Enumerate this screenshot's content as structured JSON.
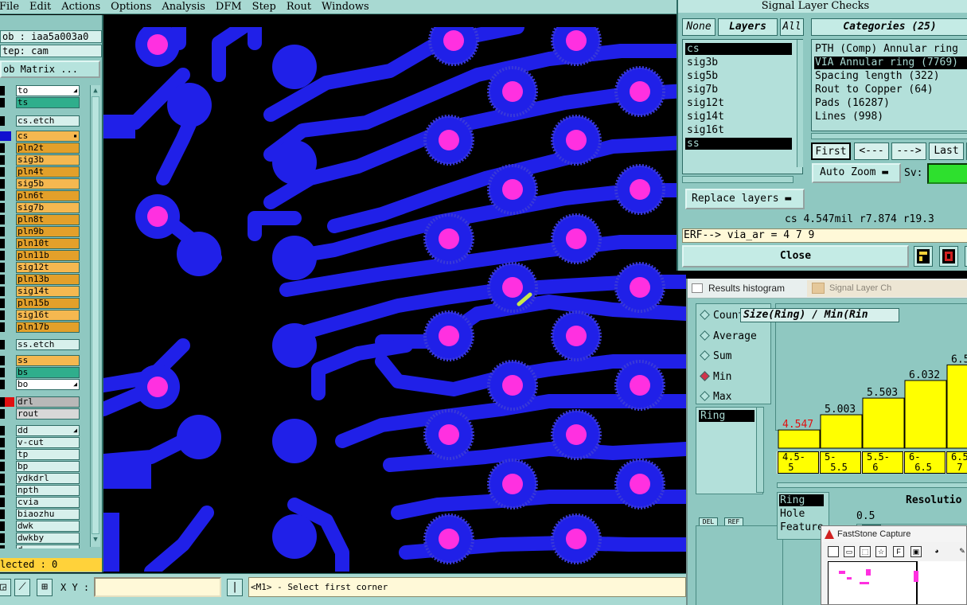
{
  "menubar": {
    "items": [
      "File",
      "Edit",
      "Actions",
      "Options",
      "Analysis",
      "DFM",
      "Step",
      "Rout",
      "Windows"
    ]
  },
  "left_panel": {
    "job": "ob : iaa5a003a0",
    "step": "tep: cam",
    "matrix_button": "ob Matrix ...",
    "layers": [
      {
        "name": "to",
        "color": "#ffffff",
        "flag": "◢"
      },
      {
        "name": "ts",
        "color": "#2fae8c"
      },
      {
        "name": "cs.etch",
        "color": "#d7f0ec"
      },
      {
        "name": "cs",
        "color": "#f5b850",
        "flag": "▪"
      },
      {
        "name": "pln2t",
        "color": "#e3a02a"
      },
      {
        "name": "sig3b",
        "color": "#f5b850"
      },
      {
        "name": "pln4t",
        "color": "#e3a02a"
      },
      {
        "name": "sig5b",
        "color": "#f5b850"
      },
      {
        "name": "pln6t",
        "color": "#e3a02a"
      },
      {
        "name": "sig7b",
        "color": "#f5b850"
      },
      {
        "name": "pln8t",
        "color": "#e3a02a"
      },
      {
        "name": "pln9b",
        "color": "#e3a02a"
      },
      {
        "name": "pln10t",
        "color": "#e3a02a"
      },
      {
        "name": "pln11b",
        "color": "#e3a02a"
      },
      {
        "name": "sig12t",
        "color": "#f5b850"
      },
      {
        "name": "pln13b",
        "color": "#e3a02a"
      },
      {
        "name": "sig14t",
        "color": "#f5b850"
      },
      {
        "name": "pln15b",
        "color": "#e3a02a"
      },
      {
        "name": "sig16t",
        "color": "#f5b850"
      },
      {
        "name": "pln17b",
        "color": "#e3a02a"
      },
      {
        "name": "ss.etch",
        "color": "#d7f0ec"
      },
      {
        "name": "ss",
        "color": "#f5b850"
      },
      {
        "name": "bs",
        "color": "#2fae8c"
      },
      {
        "name": "bo",
        "color": "#ffffff",
        "flag": "◢"
      },
      {
        "name": "drl",
        "color": "#b8b8b8"
      },
      {
        "name": "rout",
        "color": "#d8d8d8"
      },
      {
        "name": "dd",
        "color": "#d7f0ec",
        "flag": "◢"
      },
      {
        "name": "v-cut",
        "color": "#d7f0ec"
      },
      {
        "name": "tp",
        "color": "#d7f0ec"
      },
      {
        "name": "bp",
        "color": "#d7f0ec"
      },
      {
        "name": "ydkdrl",
        "color": "#d7f0ec"
      },
      {
        "name": "npth",
        "color": "#d7f0ec"
      },
      {
        "name": "cvia",
        "color": "#d7f0ec"
      },
      {
        "name": "biaozhu",
        "color": "#d7f0ec"
      },
      {
        "name": "dwk",
        "color": "#d7f0ec"
      },
      {
        "name": "dwkby",
        "color": "#d7f0ec"
      },
      {
        "name": "d",
        "color": "#d7f0ec"
      }
    ],
    "selected": "lected : 0"
  },
  "bottom_bar": {
    "xy_label": "X Y :",
    "xy_value": "",
    "prompt": "<M1> - Select first corner",
    "pipe_icon": "|"
  },
  "signal_layer_checks": {
    "title": "Signal Layer Checks",
    "tabs": {
      "none": "None",
      "layers": "Layers",
      "all": "All"
    },
    "layers": [
      {
        "name": "cs",
        "selected": true
      },
      {
        "name": "sig3b",
        "selected": false
      },
      {
        "name": "sig5b",
        "selected": false
      },
      {
        "name": "sig7b",
        "selected": false
      },
      {
        "name": "sig12t",
        "selected": false
      },
      {
        "name": "sig14t",
        "selected": false
      },
      {
        "name": "sig16t",
        "selected": false
      },
      {
        "name": "ss",
        "selected": true
      }
    ],
    "replace_button": "Replace layers",
    "categories_header": "Categories (25)",
    "categories": [
      {
        "label": "PTH (Comp) Annular ring",
        "selected": false
      },
      {
        "label": "VIA Annular ring (7769)",
        "selected": true
      },
      {
        "label": "Spacing length (322)",
        "selected": false
      },
      {
        "label": "Rout to Copper (64)",
        "selected": false
      },
      {
        "label": "Pads (16287)",
        "selected": false
      },
      {
        "label": "Lines (998)",
        "selected": false
      }
    ],
    "nav": {
      "first": "First",
      "prev": "<---",
      "next": "--->",
      "last": "Last",
      "extra": "L"
    },
    "auto_zoom": "Auto Zoom",
    "sv_label": "Sv:",
    "coord_line": "cs 4.547mil  r7.874  r19.3",
    "erf_line": "ERF--> via_ar = 4 7 9",
    "close_button": "Close"
  },
  "results_histogram": {
    "title": "Results histogram",
    "ghost_tab": "Signal Layer Ch",
    "stats": [
      {
        "label": "Count",
        "checked": false
      },
      {
        "label": "Average",
        "checked": false
      },
      {
        "label": "Sum",
        "checked": false
      },
      {
        "label": "Min",
        "checked": true
      },
      {
        "label": "Max",
        "checked": false
      }
    ],
    "ring_item": "Ring",
    "del_label": "DEL",
    "ref_label": "REF",
    "ratio_title": "Size(Ring) / Min(Rin",
    "select_items": [
      {
        "label": "Ring",
        "selected": true
      },
      {
        "label": "Hole",
        "selected": false
      },
      {
        "label": "Feature",
        "selected": false
      }
    ],
    "resolution_label": "Resolutio",
    "resolution_value": "0.5"
  },
  "chart_data": {
    "type": "bar",
    "categories": [
      "4.5-5",
      "5-5.5",
      "5.5-6",
      "6-6.5",
      "6.5-7"
    ],
    "values": [
      4.547,
      5.003,
      5.503,
      6.032,
      6.5
    ],
    "value_labels": [
      "4.547",
      "5.003",
      "5.503",
      "6.032",
      "6.5"
    ],
    "highlight_first_color": "#e01010",
    "bar_color": "#ffff00"
  },
  "faststone": {
    "title": "FastStone Capture",
    "btn_f": "F"
  },
  "colors": {
    "copper": "#2020e8",
    "pad_center": "#ff30e0",
    "panel_teal": "#8fc8c1",
    "menu_teal": "#a8d9d2",
    "selected_yellow": "#ffd23a"
  }
}
